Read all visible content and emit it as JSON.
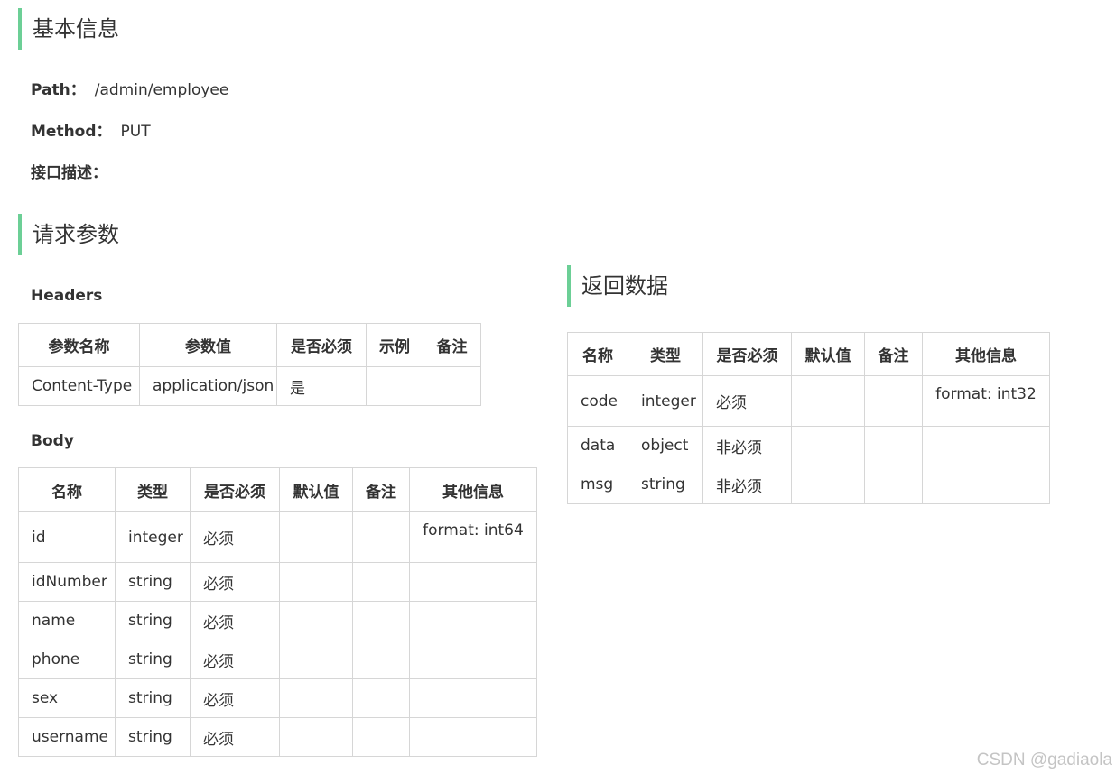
{
  "basic": {
    "title": "基本信息",
    "path_label": "Path：",
    "path_value": "/admin/employee",
    "method_label": "Method：",
    "method_value": "PUT",
    "desc_label": "接口描述："
  },
  "request": {
    "title": "请求参数",
    "headers_title": "Headers",
    "headers_cols": [
      "参数名称",
      "参数值",
      "是否必须",
      "示例",
      "备注"
    ],
    "headers_rows": [
      [
        "Content-Type",
        "application/json",
        "是",
        "",
        ""
      ]
    ],
    "body_title": "Body",
    "body_cols": [
      "名称",
      "类型",
      "是否必须",
      "默认值",
      "备注",
      "其他信息"
    ],
    "body_rows": [
      [
        "id",
        "integer",
        "必须",
        "",
        "",
        "format: int64"
      ],
      [
        "idNumber",
        "string",
        "必须",
        "",
        "",
        ""
      ],
      [
        "name",
        "string",
        "必须",
        "",
        "",
        ""
      ],
      [
        "phone",
        "string",
        "必须",
        "",
        "",
        ""
      ],
      [
        "sex",
        "string",
        "必须",
        "",
        "",
        ""
      ],
      [
        "username",
        "string",
        "必须",
        "",
        "",
        ""
      ]
    ]
  },
  "response": {
    "title": "返回数据",
    "cols": [
      "名称",
      "类型",
      "是否必须",
      "默认值",
      "备注",
      "其他信息"
    ],
    "rows": [
      [
        "code",
        "integer",
        "必须",
        "",
        "",
        "format: int32"
      ],
      [
        "data",
        "object",
        "非必须",
        "",
        "",
        ""
      ],
      [
        "msg",
        "string",
        "非必须",
        "",
        "",
        ""
      ]
    ]
  },
  "watermark": "CSDN @gadiaola"
}
